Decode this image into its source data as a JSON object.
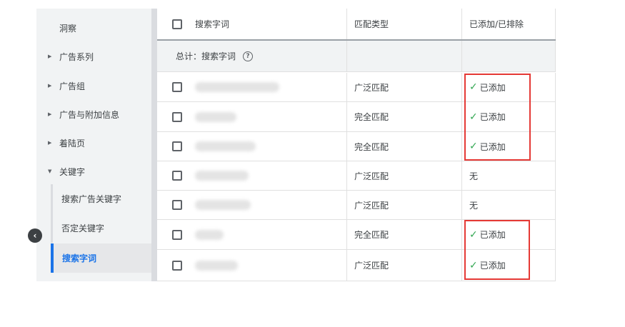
{
  "sidebar": {
    "items": [
      {
        "label": "洞察",
        "caret": ""
      },
      {
        "label": "广告系列",
        "caret": "▶"
      },
      {
        "label": "广告组",
        "caret": "▶"
      },
      {
        "label": "广告与附加信息",
        "caret": "▶"
      },
      {
        "label": "着陆页",
        "caret": "▶"
      },
      {
        "label": "关键字",
        "caret": "▼"
      }
    ],
    "sub_items": [
      {
        "label": "搜索广告关键字"
      },
      {
        "label": "否定关键字"
      },
      {
        "label": "搜索字词",
        "active": true
      }
    ],
    "collapse_icon": "‹"
  },
  "table": {
    "headers": {
      "search_term": "搜索字词",
      "match_type": "匹配类型",
      "added_excluded": "已添加/已排除"
    },
    "total_label": "总计：搜索字词",
    "help_icon": "?",
    "rows": [
      {
        "match_type": "广泛匹配",
        "status": "已添加",
        "added": true
      },
      {
        "match_type": "完全匹配",
        "status": "已添加",
        "added": true
      },
      {
        "match_type": "完全匹配",
        "status": "已添加",
        "added": true
      },
      {
        "match_type": "广泛匹配",
        "status": "无",
        "added": false
      },
      {
        "match_type": "广泛匹配",
        "status": "无",
        "added": false
      },
      {
        "match_type": "完全匹配",
        "status": "已添加",
        "added": true
      },
      {
        "match_type": "广泛匹配",
        "status": "已添加",
        "added": true
      }
    ],
    "check_glyph": "✓"
  },
  "colors": {
    "accent": "#1a73e8",
    "added_check": "#34a853",
    "highlight_box": "#e53935"
  }
}
